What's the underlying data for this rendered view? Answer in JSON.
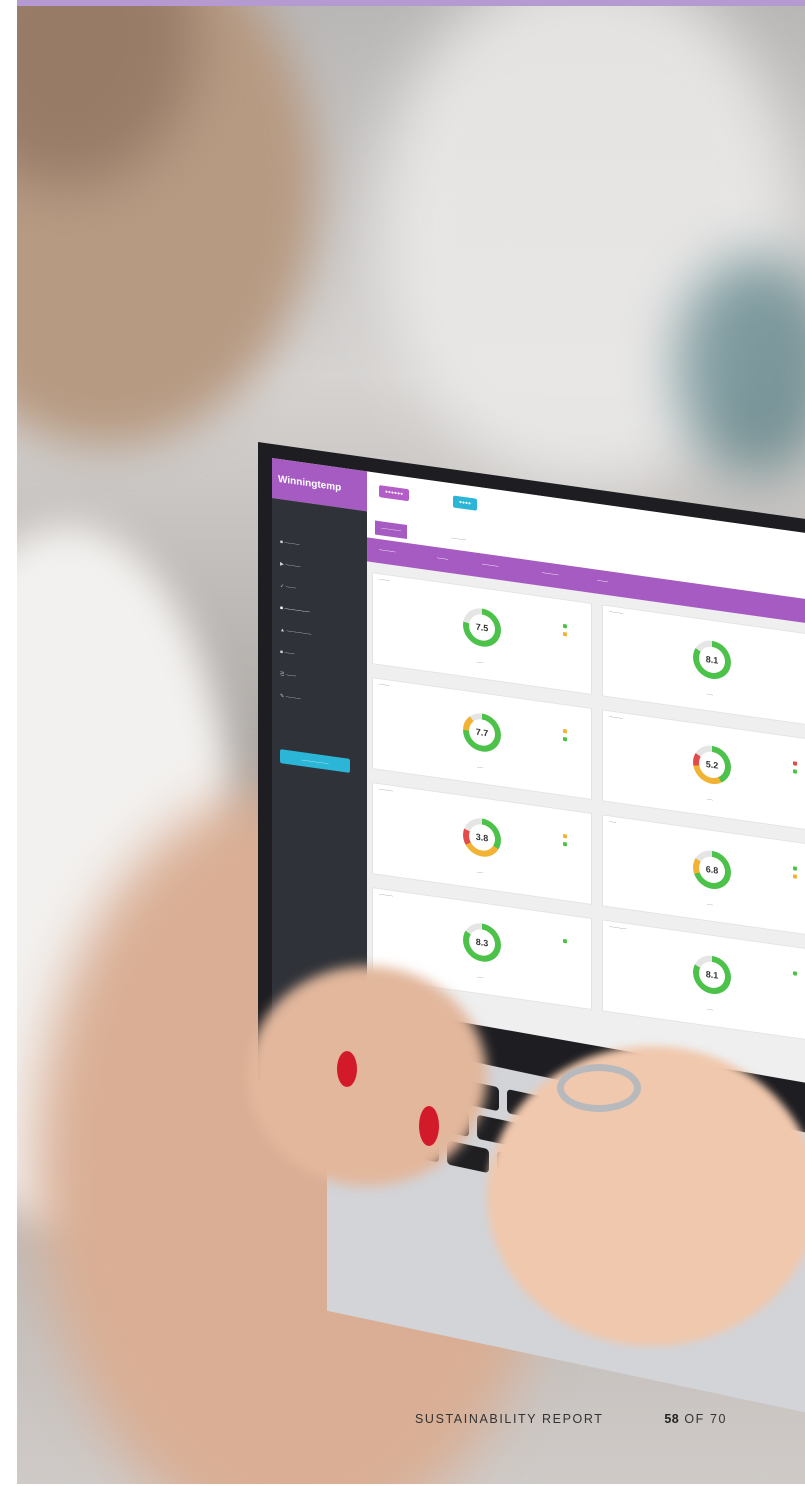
{
  "brand": {
    "accent": "#a55bc2",
    "top_bar": "#b59ad1"
  },
  "footer": {
    "report_title": "SUSTAINABILITY REPORT",
    "page_number": "58",
    "page_of": "OF 70"
  },
  "laptop_screen": {
    "app_logo": "Winningtemp",
    "gauge_values": [
      "7.5",
      "8.1",
      "7.7",
      "5.2",
      "3.8",
      "6.8",
      "8.3",
      "8.1"
    ]
  }
}
